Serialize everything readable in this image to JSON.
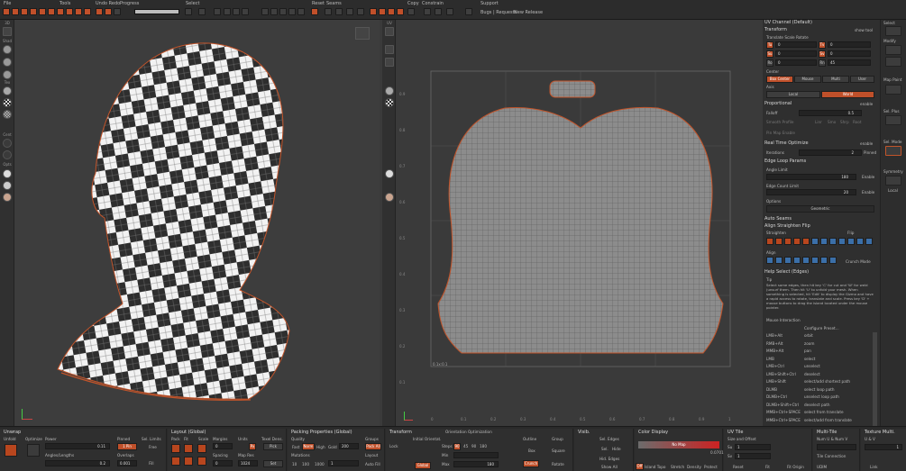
{
  "top": {
    "labels": [
      "File",
      "Tools",
      "Undo Redo",
      "Progress",
      "Select",
      "Reset",
      "Seams",
      "Copy",
      "Constrain",
      "Support"
    ],
    "support_links": [
      "Bugs | Requests",
      "New Release"
    ]
  },
  "left_tools": [
    "3D",
    "Shad",
    "Tex",
    "Cent",
    "Opts"
  ],
  "uv_view": {
    "ticks_y": [
      "0.9",
      "0.8",
      "0.7",
      "0.6",
      "0.5",
      "0.4",
      "0.3",
      "0.2",
      "0.1"
    ],
    "ticks_x": [
      "0",
      "0.1",
      "0.2",
      "0.3",
      "0.4",
      "0.5",
      "0.6",
      "0.7",
      "0.8",
      "0.9",
      "1"
    ],
    "corner": "UV",
    "tile": "0.1x:0.1"
  },
  "right": {
    "channel": "UV Channel (Default)",
    "transform": {
      "title": "Transform",
      "show": "show tool",
      "translate": "Translate Scale Rotate",
      "tu": "Tu",
      "tv": "Tv",
      "su": "Su",
      "sv": "Sv",
      "ro": "Ro",
      "rn": "Rn",
      "tu_val": "0",
      "tv_val": "0",
      "su_val": "0",
      "sv_val": "0",
      "ro_val": "0",
      "rn_val": "45"
    },
    "center": {
      "title": "Center",
      "opts": [
        "Box Center",
        "Mouse",
        "Multi",
        "User"
      ]
    },
    "axis": {
      "title": "Axis",
      "opts": [
        "Local",
        "World"
      ]
    },
    "proportional": {
      "title": "Proportional",
      "state": "enable",
      "falloff": "Falloff",
      "falloff_val": "0.5",
      "smooth": "Smooth Profile",
      "shapes": [
        "Linr",
        "Smo",
        "Shrp",
        "Root"
      ],
      "pin": "Pin Map Enable"
    },
    "realtime": {
      "title": "Real Time Optimize",
      "state": "enable",
      "iter": "Iterations",
      "iter_val": "2",
      "pinned": "Pinned"
    },
    "edgeloop": {
      "title": "Edge Loop Params",
      "angle": "Angle Limit",
      "angle_val": "180",
      "count": "Edge Count Limit",
      "count_val": "20",
      "enable": "Enable",
      "options": "Options",
      "geometric": "Geometric"
    },
    "autoseams": "Auto Seams",
    "align": {
      "title": "Align Straighten Flip",
      "straighten": "Straighten",
      "flip": "Flip",
      "align": "Align",
      "crunch": "Crunch Mode"
    },
    "help": {
      "title": "Help Select (Edges)",
      "tip_label": "Tip",
      "tip": "Select some edges, then hit key 'C' for cut and 'W' for weld (unsurf them. Then hit 'U' to unfold your mesh. When something is selected, hit 'Edit' to display the Gizmo and have a rapid access to rotate, translate and scale. Press key 'D' + mouse buttons to drag the island located under the mouse pointer.",
      "mouse": "Mouse Interaction",
      "configure": "Configure Preset...",
      "rows": [
        [
          "LMB+Alt",
          "orbit"
        ],
        [
          "RMB+Alt",
          "zoom"
        ],
        [
          "MMB+Alt",
          "pan"
        ],
        [
          "LMB",
          "select"
        ],
        [
          "LMB+Ctrl",
          "unselect"
        ],
        [
          "LMB+Shift+Ctrl",
          "deselect"
        ],
        [
          "LMB+Shift",
          "select/add shortest path"
        ],
        [
          "DLMB",
          "select loop path"
        ],
        [
          "DLMB+Ctrl",
          "unselect loop path"
        ],
        [
          "DLMB+Shift+Ctrl",
          "deselect path"
        ],
        [
          "MMB+Ctrl+SPACE",
          "select from translate"
        ],
        [
          "MMB+Ctrl+SPACE",
          "select/add from translate"
        ]
      ]
    }
  },
  "far_right": {
    "select": "Select",
    "modify": "Modify",
    "map": "Map Paint",
    "sel_plus": "Sel. Plus",
    "sel_mode": "Sel. Mode",
    "symmetry": "Symmetry",
    "local": "Local"
  },
  "bottom": {
    "unwrap": {
      "title": "Unwrap",
      "unfold": "Unfold",
      "optimize": "Optimize",
      "power": "Power",
      "angles": "Angles/Lengths",
      "power_val": "0.11",
      "angles_val": "0.2"
    },
    "pinned": {
      "title": "Pinned",
      "one": "1 Pin",
      "overlap": "Overlaps",
      "overlap_val": "0.001"
    },
    "sel": {
      "title": "Sel. Limits",
      "free": "Free",
      "fill": "Fill"
    },
    "layout": {
      "title": "Layout (Global)",
      "pack": "Pack",
      "fit": "Fit",
      "scale": "Scale",
      "margins": "Margins",
      "units": "Units",
      "margin_val": "0",
      "px": "Px",
      "spacing": "Spacing",
      "spacing_val": "0",
      "map_res": "Map Res",
      "map_res_val": "1024",
      "texel": "Texel Dens.",
      "pick": "Pick",
      "set": "Set"
    },
    "packing": {
      "title": "Packing Properties (Global)",
      "quality": "Quality",
      "fast": "Fast",
      "norm": "Norm",
      "high": "High",
      "gold": "Gold",
      "gold_val": "200",
      "mutations": "Mutations",
      "mut": [
        "10",
        "100",
        "1000",
        "1"
      ],
      "groups": "Groups",
      "layout": "Layout",
      "auto_fill": "Auto Fill",
      "pack_all": "Pack All"
    },
    "transform": {
      "title": "Transform",
      "lock": "Lock",
      "initial": "Initial Orientat.",
      "steps": "Steps",
      "step_val": "90",
      "deg": [
        "45",
        "90",
        "180"
      ],
      "min": "Min",
      "max": "Max",
      "max_val": "180",
      "opt": "Orientation Optimization",
      "global": "Global",
      "outline": "Outline",
      "box": "Box",
      "group": "Group",
      "square": "Square",
      "crunch": "Crunch",
      "rotate": "Rotate"
    },
    "vis": {
      "title": "Visib.",
      "sel_edges": "Sel. Edges",
      "sel": "Sel.",
      "hide": "Hide",
      "hid_edges": "Hid. Edges",
      "show_all": "Show All"
    },
    "color": {
      "title": "Color Display",
      "map": "No Map",
      "val": "0.0701",
      "off": "Off",
      "island": "Island Topo",
      "stretch": "Stretch",
      "density": "Density",
      "protect": "Protect"
    },
    "tile": {
      "title": "UV Tile",
      "size": "Size and Offset",
      "su": "Su",
      "sv": "Sv",
      "su_val": "1",
      "sv_val": "1",
      "reset": "Reset",
      "fit": "Fit",
      "fit_origin": "Fit Origin"
    },
    "multi": {
      "title": "Multi-Tile",
      "num": "Num U & Num V",
      "tile_conn": "Tile Connection",
      "udim": "UDIM"
    },
    "tex": {
      "title": "Texture Multi.",
      "uv": "U & V",
      "val": "1",
      "link": "Link"
    }
  }
}
